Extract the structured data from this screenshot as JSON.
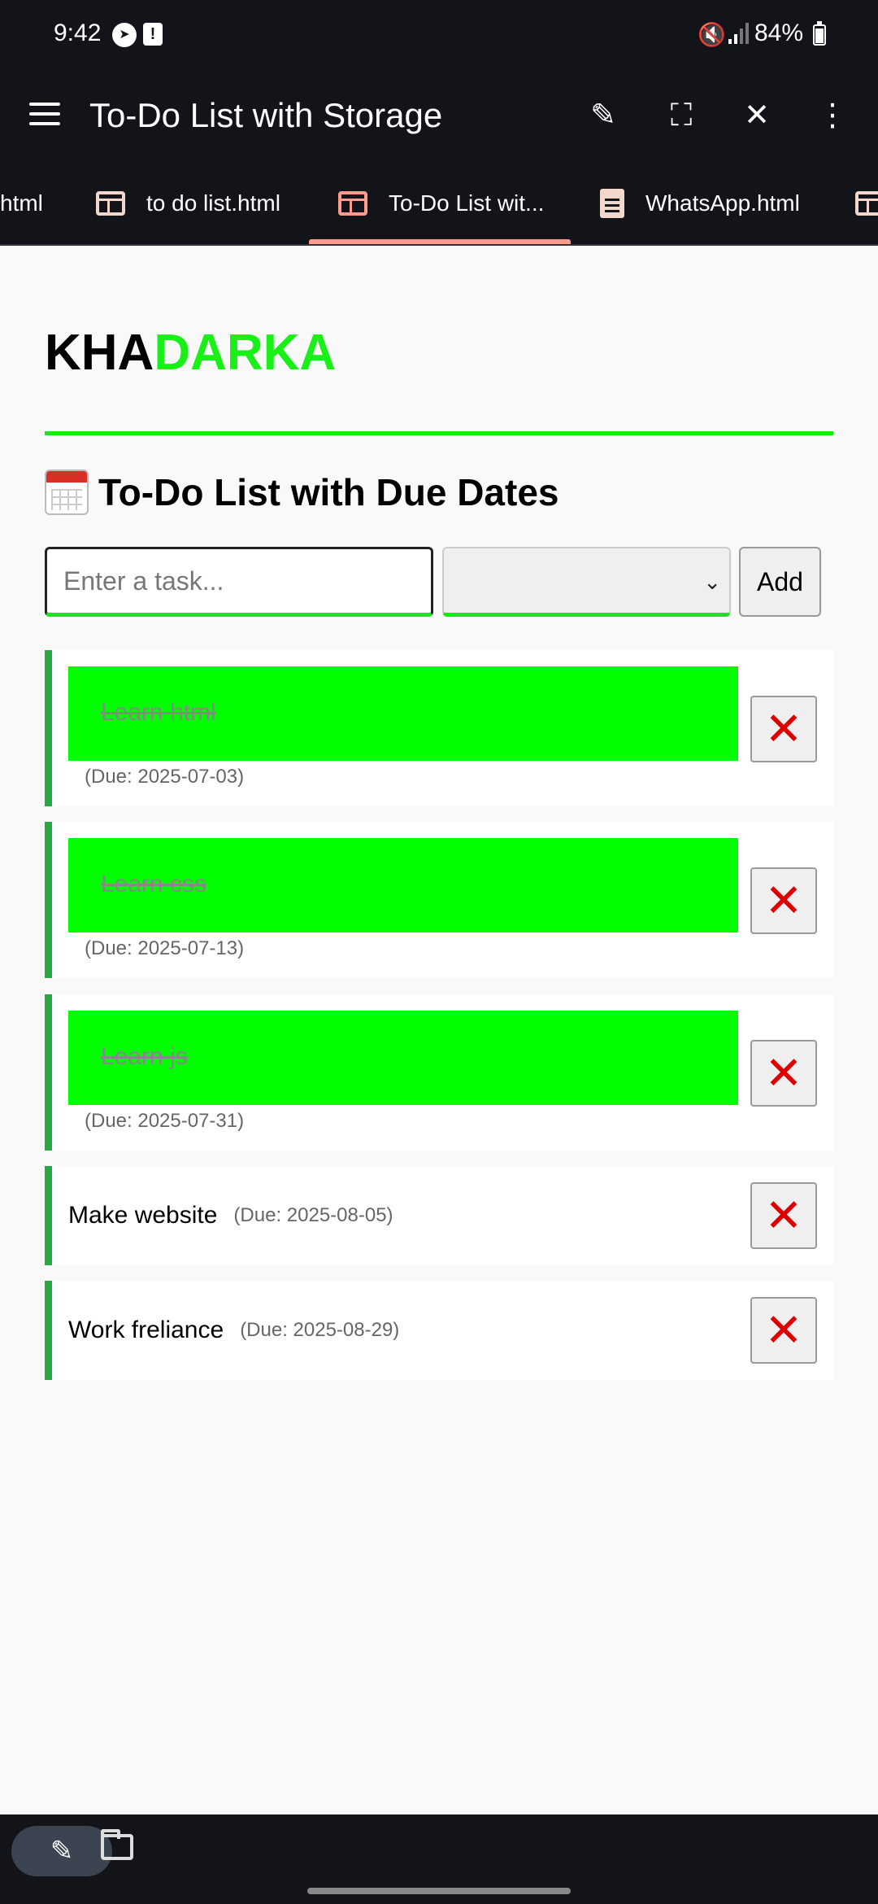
{
  "status_bar": {
    "time": "9:42",
    "battery": "84%",
    "icons": [
      "telegram-icon",
      "alert-icon",
      "mute-icon",
      "signal-icon",
      "battery-icon"
    ]
  },
  "app_bar": {
    "title": "To-Do List with Storage",
    "actions": [
      "edit-icon",
      "fullscreen-icon",
      "close-icon",
      "more-icon"
    ]
  },
  "tabs": [
    {
      "label": "html"
    },
    {
      "label": "to do list.html"
    },
    {
      "label": "To-Do List wit..."
    },
    {
      "label": "WhatsApp.html"
    }
  ],
  "page": {
    "logo_part1": "KHA",
    "logo_part2": "DARKA",
    "heading_text": "To-Do List with Due Dates",
    "task_placeholder": "Enter a task...",
    "date_value": "",
    "add_label": "Add"
  },
  "tasks": [
    {
      "name": "Learn html",
      "due": "(Due: 2025-07-03)",
      "completed": true
    },
    {
      "name": "Learn css",
      "due": "(Due: 2025-07-13)",
      "completed": true
    },
    {
      "name": "Learn js",
      "due": "(Due: 2025-07-31)",
      "completed": true
    },
    {
      "name": "Make website",
      "due": "(Due: 2025-08-05)",
      "completed": false
    },
    {
      "name": "Work freliance",
      "due": "(Due: 2025-08-29)",
      "completed": false
    }
  ],
  "delete_symbol": "✕",
  "colors": {
    "accent_green": "#18e818",
    "done_highlight": "#00ff00",
    "border_green": "#28a745",
    "delete_red": "#dd0000",
    "chrome_dark": "#12141a",
    "active_tab": "#ff9a8e"
  }
}
